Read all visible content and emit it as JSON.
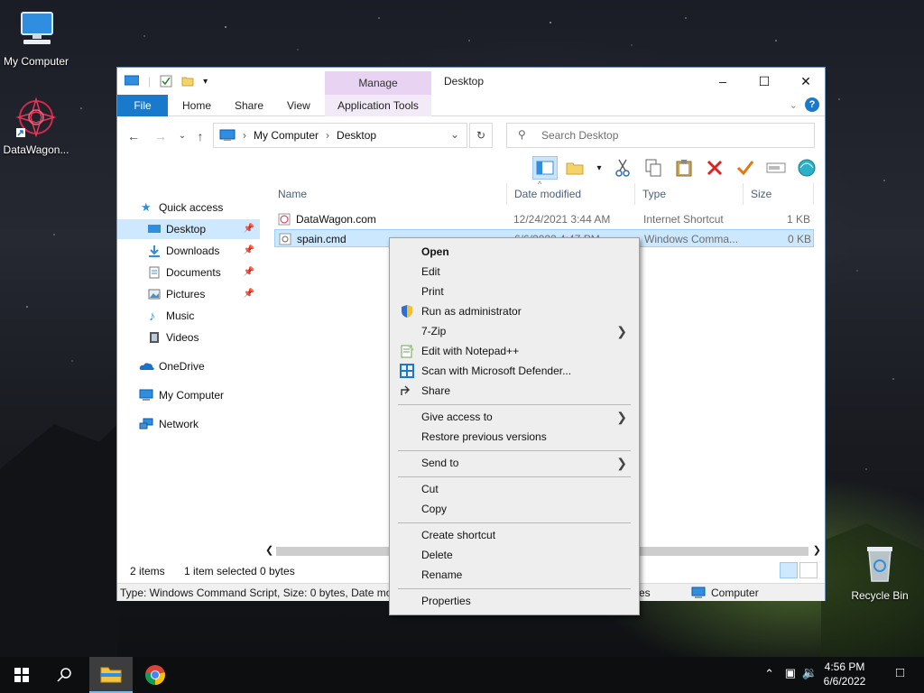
{
  "desktop": {
    "icons": [
      {
        "label": "My Computer"
      },
      {
        "label": "DataWagon..."
      },
      {
        "label": "Recycle Bin"
      }
    ]
  },
  "window": {
    "title": "Desktop",
    "manage_tab": "Manage",
    "ribbon_tabs": [
      "File",
      "Home",
      "Share",
      "View",
      "Application Tools"
    ],
    "address_crumbs": [
      "My Computer",
      "Desktop"
    ],
    "search_placeholder": "Search Desktop",
    "nav": [
      {
        "label": "Quick access",
        "icon": "star-icon",
        "pinned": false
      },
      {
        "label": "Desktop",
        "icon": "desktop-folder-icon",
        "pinned": true
      },
      {
        "label": "Downloads",
        "icon": "downloads-icon",
        "pinned": true
      },
      {
        "label": "Documents",
        "icon": "documents-icon",
        "pinned": true
      },
      {
        "label": "Pictures",
        "icon": "pictures-icon",
        "pinned": true
      },
      {
        "label": "Music",
        "icon": "music-icon",
        "pinned": false
      },
      {
        "label": "Videos",
        "icon": "videos-icon",
        "pinned": false
      },
      {
        "label": "OneDrive",
        "icon": "onedrive-icon",
        "pinned": false
      },
      {
        "label": "My Computer",
        "icon": "computer-icon",
        "pinned": false
      },
      {
        "label": "Network",
        "icon": "network-icon",
        "pinned": false
      }
    ],
    "columns": [
      "Name",
      "Date modified",
      "Type",
      "Size"
    ],
    "files": [
      {
        "name": "DataWagon.com",
        "date": "12/24/2021 3:44 AM",
        "type": "Internet Shortcut",
        "size": "1 KB"
      },
      {
        "name": "spain.cmd",
        "date": "6/6/2022 4:47 PM",
        "type": "Windows Comma...",
        "size": "0 KB"
      }
    ],
    "status": {
      "items": "2 items",
      "selected": "1 item selected",
      "bytes": "0 bytes"
    },
    "detail_text": "Type: Windows Command Script, Size: 0 bytes, Date mod",
    "detail_tail": "es",
    "detail_zone": "Computer"
  },
  "context_menu": {
    "items": [
      {
        "label": "Open",
        "bold": true
      },
      {
        "label": "Edit"
      },
      {
        "label": "Print"
      },
      {
        "label": "Run as administrator",
        "icon": "shield-icon"
      },
      {
        "label": "7-Zip",
        "submenu": true
      },
      {
        "label": "Edit with Notepad++",
        "icon": "notepad-icon"
      },
      {
        "label": "Scan with Microsoft Defender...",
        "icon": "defender-icon"
      },
      {
        "label": "Share",
        "icon": "share-icon"
      },
      {
        "label": "Give access to",
        "submenu": true
      },
      {
        "label": "Restore previous versions"
      },
      {
        "label": "Send to",
        "submenu": true
      },
      {
        "label": "Cut"
      },
      {
        "label": "Copy"
      },
      {
        "label": "Create shortcut"
      },
      {
        "label": "Delete"
      },
      {
        "label": "Rename"
      },
      {
        "label": "Properties"
      }
    ]
  },
  "taskbar": {
    "time": "4:56 PM",
    "date": "6/6/2022"
  },
  "colors": {
    "accent": "#1979ca",
    "selection": "#cce8ff",
    "manage_tab": "#e8d3f2"
  }
}
